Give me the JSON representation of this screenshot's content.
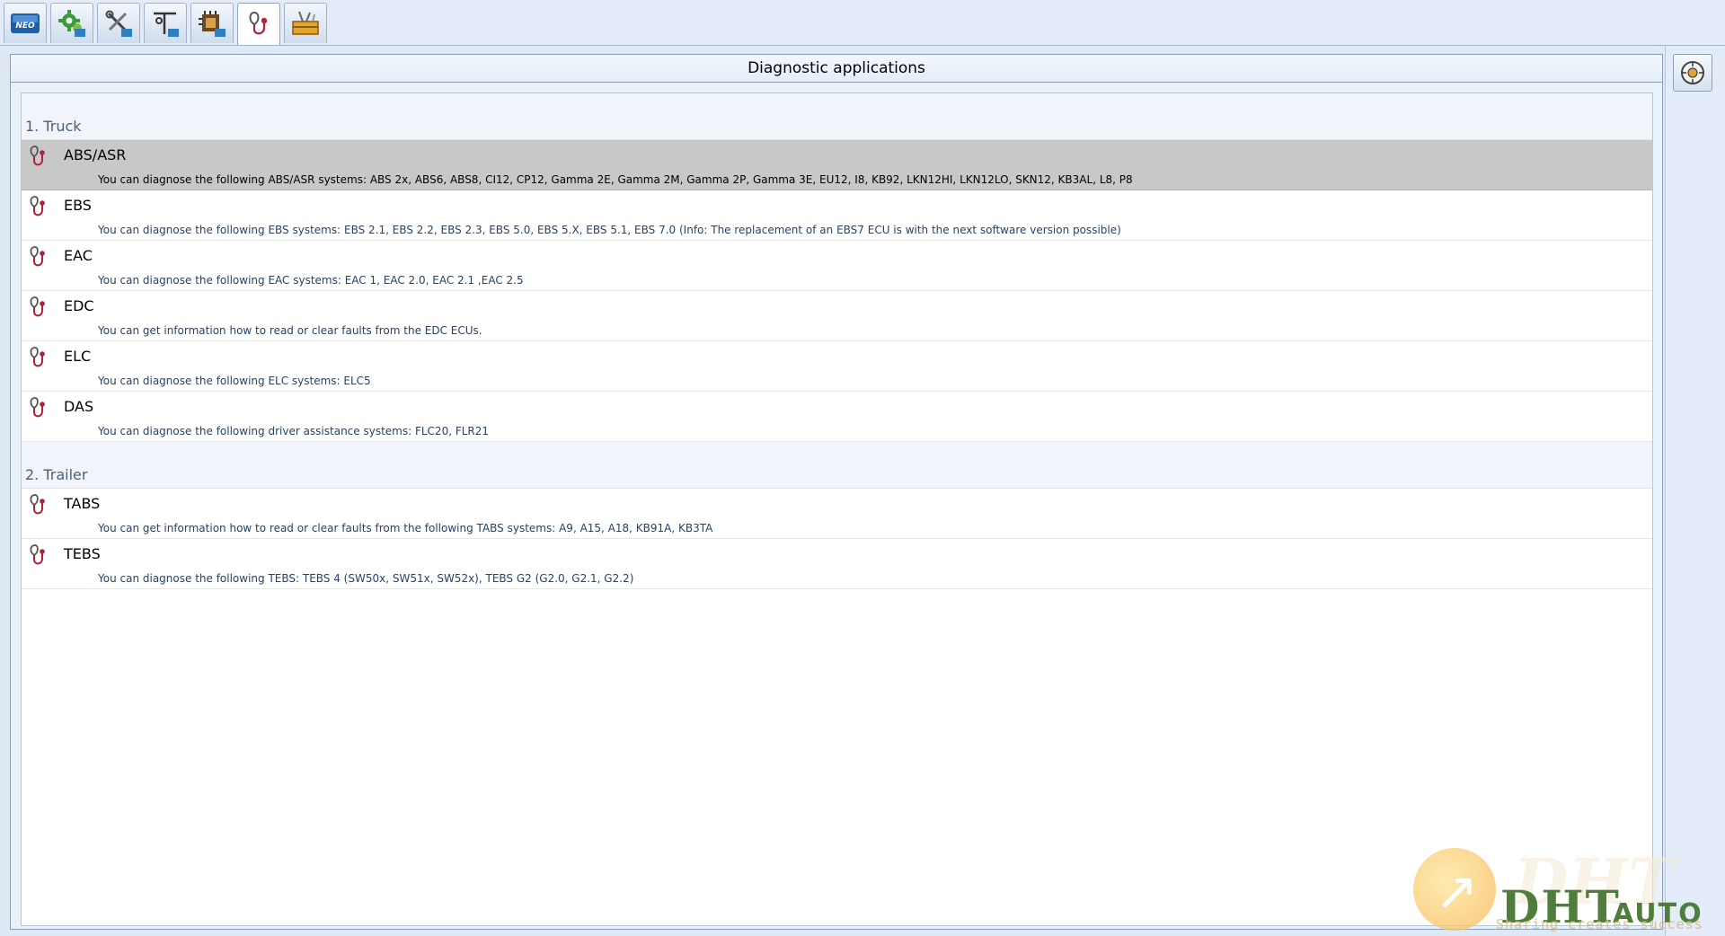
{
  "toolbar": {
    "tabs": [
      {
        "id": "neo",
        "icon": "neo-logo-icon",
        "label": "NEO"
      },
      {
        "id": "gear",
        "icon": "gear-settings-icon"
      },
      {
        "id": "tools",
        "icon": "tools-icon"
      },
      {
        "id": "measure",
        "icon": "measure-instrument-icon"
      },
      {
        "id": "ecu",
        "icon": "ecu-chip-icon"
      },
      {
        "id": "diagnostics",
        "icon": "stethoscope-icon",
        "active": true
      },
      {
        "id": "toolbox",
        "icon": "toolbox-icon"
      }
    ]
  },
  "panel": {
    "title": "Diagnostic applications",
    "sections": [
      {
        "heading": "1. Truck",
        "items": [
          {
            "title": "ABS/ASR",
            "desc": "You can diagnose the following ABS/ASR systems: ABS 2x, ABS6, ABS8, CI12, CP12, Gamma 2E, Gamma 2M, Gamma 2P, Gamma 3E, EU12, I8, KB92, LKN12HI, LKN12LO, SKN12, KB3AL, L8, P8",
            "selected": true
          },
          {
            "title": "EBS",
            "desc": "You can diagnose the following EBS systems: EBS 2.1, EBS 2.2, EBS 2.3, EBS 5.0, EBS 5.X, EBS 5.1, EBS 7.0  (Info: The replacement of an EBS7 ECU is with the next software version possible)"
          },
          {
            "title": "EAC",
            "desc": "You can diagnose the following EAC systems: EAC 1, EAC 2.0, EAC 2.1 ,EAC 2.5"
          },
          {
            "title": "EDC",
            "desc": "You can get information how to read or clear faults from the EDC ECUs."
          },
          {
            "title": "ELC",
            "desc": "You can diagnose the following ELC systems: ELC5"
          },
          {
            "title": "DAS",
            "desc": "You can diagnose the following driver assistance systems: FLC20, FLR21"
          }
        ]
      },
      {
        "heading": "2. Trailer",
        "items": [
          {
            "title": "TABS",
            "desc": "You can get information how to read or clear faults from the following TABS systems: A9, A15, A18, KB91A, KB3TA"
          },
          {
            "title": "TEBS",
            "desc": "You can diagnose the following TEBS: TEBS 4 (SW50x, SW51x, SW52x), TEBS G2 (G2.0, G2.1, G2.2)"
          }
        ]
      }
    ]
  },
  "side_button": {
    "icon": "compass-settings-icon"
  },
  "watermark": {
    "brand": "DHT",
    "suffix": "AUTO",
    "slogan": "Sharing creates success"
  },
  "colors": {
    "accent_icon": "#b2213a",
    "selected_row": "#c8c8c8",
    "desc_text": "#26436a",
    "section_text": "#4b6076"
  }
}
